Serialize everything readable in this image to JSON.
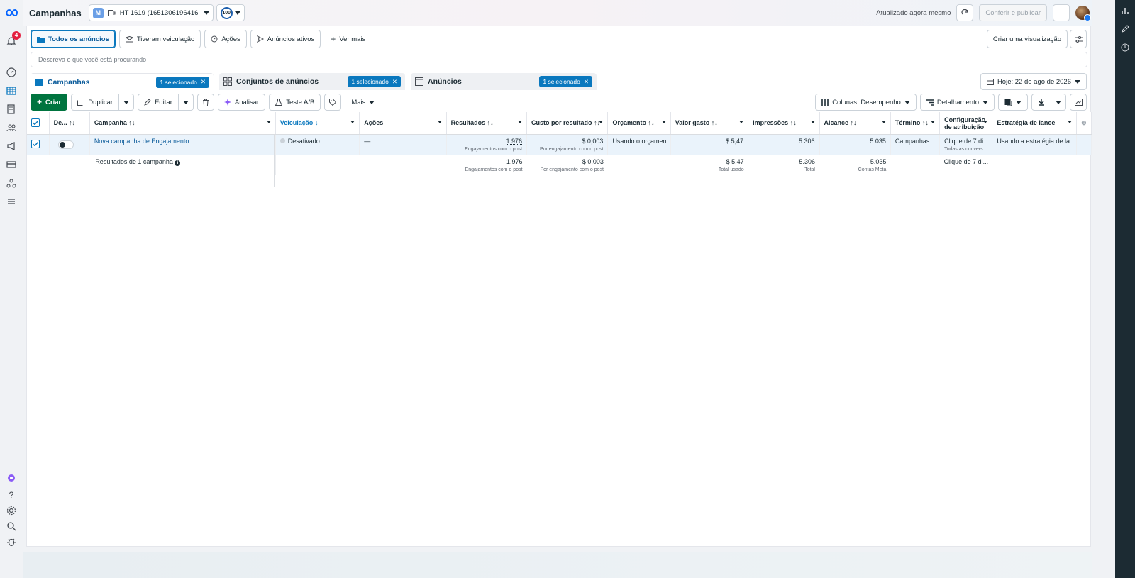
{
  "header": {
    "title": "Campanhas",
    "account_badge": "M",
    "account_name": "HT 1619 (1651306196416...",
    "score": "100",
    "updated": "Atualizado agora mesmo",
    "review_publish": "Conferir e publicar",
    "more": "···"
  },
  "rail": {
    "notifications_count": "4"
  },
  "filters": {
    "items": [
      "Todos os anúncios",
      "Tiveram veiculação",
      "Ações",
      "Anúncios ativos",
      "Ver mais"
    ],
    "create_view": "Criar uma visualização"
  },
  "search": {
    "placeholder": "Descreva o que você está procurando"
  },
  "levels": {
    "campaigns": "Campanhas",
    "adsets": "Conjuntos de anúncios",
    "ads": "Anúncios",
    "selected": "1 selecionado"
  },
  "date_range": "Hoje: 22 de ago de 2026",
  "toolbar": {
    "create": "Criar",
    "duplicate": "Duplicar",
    "edit": "Editar",
    "analyze": "Analisar",
    "ab_test": "Teste A/B",
    "more": "Mais",
    "columns": "Colunas: Desempenho",
    "breakdown": "Detalhamento"
  },
  "table": {
    "headers": {
      "delivery_toggle": "De...",
      "campaign": "Campanha",
      "delivery": "Veiculação",
      "actions": "Ações",
      "results": "Resultados",
      "cost_per_result": "Custo por resultado",
      "budget": "Orçamento",
      "amount_spent": "Valor gasto",
      "impressions": "Impressões",
      "reach": "Alcance",
      "end": "Término",
      "attribution_line1": "Configuração",
      "attribution_line2": "de atribuição",
      "bid_strategy": "Estratégia de lance"
    },
    "row": {
      "campaign": "Nova campanha de Engajamento",
      "delivery": "Desativado",
      "actions": "—",
      "results": "1.976",
      "results_sub": "Engajamentos com o post",
      "cost": "$ 0,003",
      "cost_sub": "Por engajamento com o post",
      "budget": "Usando o orçamen...",
      "spent": "$ 5,47",
      "impressions": "5.306",
      "reach": "5.035",
      "end": "Campanhas ...",
      "attribution": "Clique de 7 di...",
      "attribution_sub": "Todas as convers...",
      "bid": "Usando a estratégia de la..."
    },
    "summary": {
      "label": "Resultados de 1 campanha",
      "results": "1.976",
      "results_sub": "Engajamentos com o post",
      "cost": "$ 0,003",
      "cost_sub": "Por engajamento com o post",
      "spent": "$ 5,47",
      "spent_sub": "Total usado",
      "impressions": "5.306",
      "impressions_sub": "Total",
      "reach": "5.035",
      "reach_sub": "Contas Meta",
      "attribution": "Clique de 7 di..."
    }
  },
  "colors": {
    "accent": "#0a78be",
    "create_green": "#00743f",
    "notification_red": "#e41e3f"
  }
}
